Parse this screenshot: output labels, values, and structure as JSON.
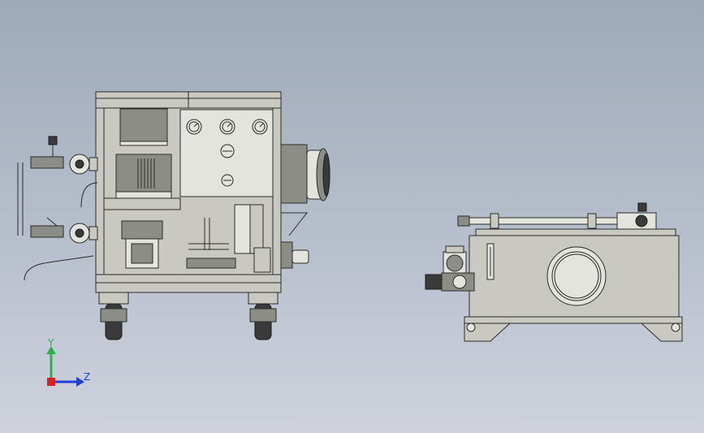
{
  "triad": {
    "y_label": "Y",
    "z_label": "Z",
    "y_color": "#2bb34a",
    "z_color": "#1f3fd6",
    "x_color": "#d42020"
  },
  "background": {
    "top": "#9eaab8",
    "bottom": "#cfd2dd"
  }
}
